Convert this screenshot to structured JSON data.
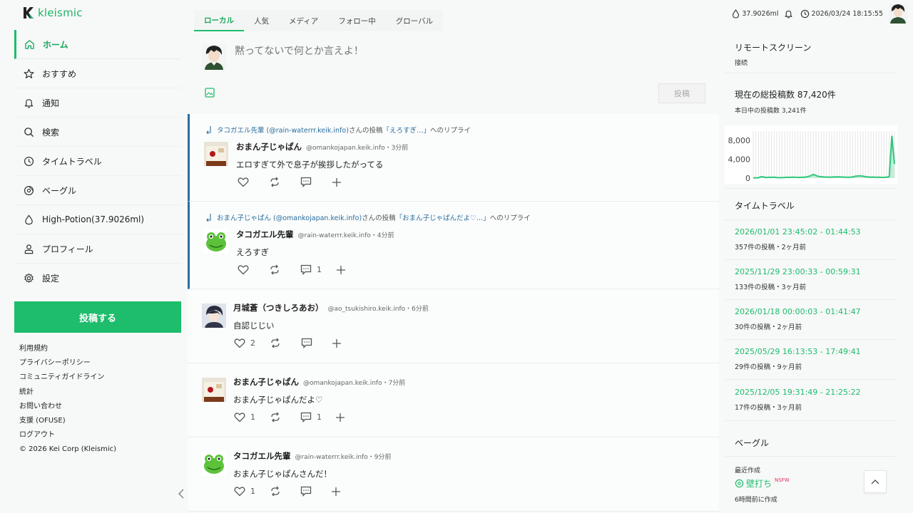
{
  "brand": {
    "logo_text": "kleismic"
  },
  "nav": [
    {
      "label": "ホーム",
      "icon": "home-icon"
    },
    {
      "label": "おすすめ",
      "icon": "star-icon"
    },
    {
      "label": "通知",
      "icon": "bell-icon"
    },
    {
      "label": "検索",
      "icon": "search-icon"
    },
    {
      "label": "タイムトラベル",
      "icon": "clock-icon"
    },
    {
      "label": "ベーグル",
      "icon": "bagel-icon"
    },
    {
      "label": "High-Potion(37.9026ml)",
      "icon": "drop-icon"
    },
    {
      "label": "プロフィール",
      "icon": "user-icon"
    },
    {
      "label": "設定",
      "icon": "gear-icon"
    }
  ],
  "post_button": "投稿する",
  "footer": {
    "links": [
      "利用規約",
      "プライバシーポリシー",
      "コミュニティガイドライン",
      "統計",
      "お問い合わせ",
      "支援 (OFUSE)",
      "ログアウト"
    ],
    "copyright": "© 2026 Kei Corp (Kleismic)"
  },
  "tabs": [
    "ローカル",
    "人気",
    "メディア",
    "フォロー中",
    "グローバル"
  ],
  "composer": {
    "placeholder": "黙ってないで何とか言えよ！",
    "submit": "投稿"
  },
  "posts": [
    {
      "reply_user": "タコガエル先輩 (@rain-waterrr.keik.info)",
      "reply_mid": " さんの投稿",
      "reply_quote": "「えろすぎ…」",
      "reply_tail": " へのリプライ",
      "name": "おまん子じゃぱん",
      "handle": "@omankojapan.keik.info・3分前",
      "text": "エロすぎて外で息子が挨拶したがってる",
      "likes": "",
      "replies": ""
    },
    {
      "reply_user": "おまん子じゃぱん (@omankojapan.keik.info)",
      "reply_mid": " さんの投稿",
      "reply_quote": "「おまん子じゃぱんだよ♡…」",
      "reply_tail": " へのリプライ",
      "name": "タコガエル先輩",
      "handle": "@rain-waterrr.keik.info・4分前",
      "text": "えろすぎ",
      "likes": "",
      "replies": "1"
    },
    {
      "name": "月城蒼（つきしろあお）",
      "handle": "@ao_tsukishiro.keik.info・6分前",
      "text": "自認じじい",
      "likes": "2",
      "replies": ""
    },
    {
      "name": "おまん子じゃぱん",
      "handle": "@omankojapan.keik.info・7分前",
      "text": "おまん子じゃぱんだよ♡",
      "likes": "1",
      "replies": "1"
    },
    {
      "name": "タコガエル先輩",
      "handle": "@rain-waterrr.keik.info・9分前",
      "text": "おまん子じゃぱんさんだ！",
      "likes": "1",
      "replies": ""
    }
  ],
  "topbar": {
    "potion": "37.9026ml",
    "datetime": "2026/03/24 18:15:55"
  },
  "remote_screen": {
    "title": "リモートスクリーン",
    "action": "接続"
  },
  "stats": {
    "total": "現在の総投稿数 87,420件",
    "today": "本日中の投稿数 3,241件"
  },
  "chart_data": {
    "type": "area",
    "y_ticks": [
      "8,000",
      "4,000",
      "0"
    ],
    "ylim": [
      0,
      10000
    ],
    "values": [
      50,
      60,
      80,
      300,
      250,
      120,
      180,
      150,
      200,
      120,
      100,
      110,
      130,
      180,
      150,
      200,
      180,
      150,
      160,
      190,
      200,
      350,
      500,
      800,
      550,
      350,
      300,
      250,
      230,
      200,
      220,
      260,
      250,
      280,
      220,
      200,
      180,
      190,
      250,
      400,
      450,
      500,
      400,
      300,
      250,
      200,
      220,
      180,
      200,
      150,
      150,
      200,
      300,
      9000,
      3000
    ],
    "color": "#2ec77a"
  },
  "timetravel": {
    "title": "タイムトラベル",
    "items": [
      {
        "range": "2026/01/01 23:45:02 - 01:44:53",
        "meta": "357件の投稿・2ヶ月前"
      },
      {
        "range": "2025/11/29 23:00:33 - 00:59:31",
        "meta": "133件の投稿・3ヶ月前"
      },
      {
        "range": "2026/01/18 00:00:03 - 01:41:47",
        "meta": "30件の投稿・2ヶ月前"
      },
      {
        "range": "2025/05/29 16:13:53 - 17:49:41",
        "meta": "29件の投稿・9ヶ月前"
      },
      {
        "range": "2025/12/05 19:31:49 - 21:25:22",
        "meta": "17件の投稿・3ヶ月前"
      }
    ]
  },
  "bagel": {
    "title": "ベーグル",
    "recent": "最近作成",
    "name": "壁打ち",
    "badge": "NSFW",
    "created": "6時間前に作成"
  },
  "colors": {
    "accent": "#1dbd6b",
    "reply_bar": "#2a6e9e"
  }
}
